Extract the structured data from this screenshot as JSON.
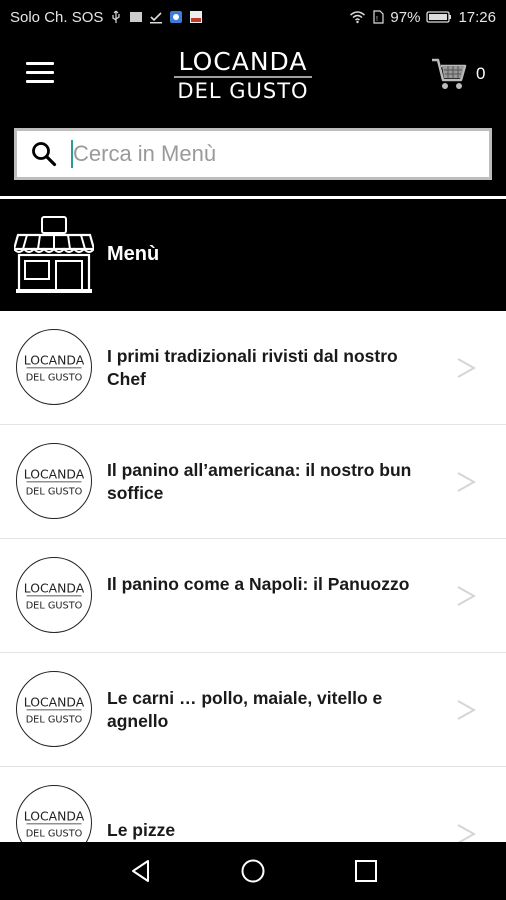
{
  "status_bar": {
    "carrier": "Solo Ch. SOS",
    "battery": "97%",
    "time": "17:26"
  },
  "header": {
    "logo_line1": "LOCANDA",
    "logo_line2": "DEL GUSTO",
    "cart_count": "0"
  },
  "search": {
    "placeholder": "Cerca in Menù"
  },
  "menu": {
    "title": "Menù",
    "items": [
      {
        "label": "I primi tradizionali rivisti dal nostro Chef"
      },
      {
        "label": "Il panino all’americana: il nostro bun soffice"
      },
      {
        "label": "Il panino come a Napoli: il Panuozzo"
      },
      {
        "label": "Le carni … pollo, maiale, vitello e agnello"
      },
      {
        "label": "Le pizze"
      }
    ]
  },
  "colors": {
    "background": "#000000",
    "list_background": "#ffffff",
    "search_caret": "#2a9d8f"
  }
}
